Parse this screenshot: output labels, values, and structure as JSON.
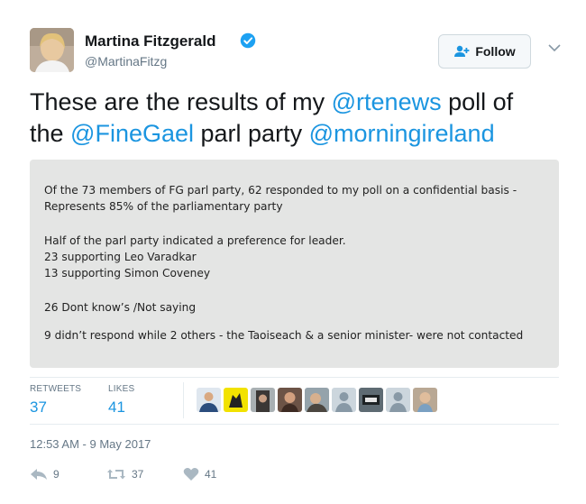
{
  "author": {
    "name": "Martina Fitzgerald",
    "handle": "@MartinaFitzg",
    "verified": true
  },
  "follow_button": {
    "label": "Follow",
    "icon": "add-user-icon"
  },
  "menu_icon": "chevron-down-icon",
  "tweet": {
    "line1": [
      "These are the results of my ",
      "@rtenews",
      " poll of"
    ],
    "line2": [
      "the ",
      "@FineGael",
      " parl party ",
      "@morningireland"
    ]
  },
  "photo_lines": [
    "Of the 73 members of FG parl party, 62 responded to my poll on a confidential basis -",
    "Represents 85% of the parliamentary party",
    "Half of the parl party indicated a preference for leader.",
    "23 supporting Leo Varadkar",
    "13 supporting Simon Coveney",
    "26 Dont know’s /Not saying",
    "9 didn’t respond while 2 others - the Taoiseach & a senior minister- were not contacted"
  ],
  "stats": {
    "retweets_label": "RETWEETS",
    "retweets_value": "37",
    "likes_label": "LIKES",
    "likes_value": "41"
  },
  "timestamp": "12:53 AM - 9 May 2017",
  "actions": {
    "reply_count": "9",
    "retweet_count": "37",
    "like_count": "41"
  },
  "colors": {
    "link": "#1b95e0",
    "secondary": "#657786",
    "verified": "#1da1f2"
  }
}
